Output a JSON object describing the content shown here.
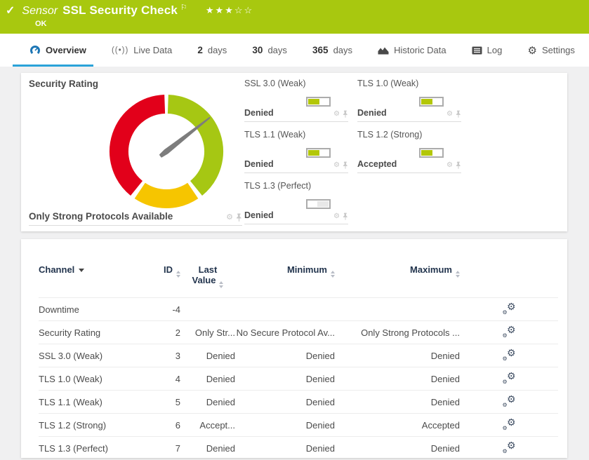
{
  "header": {
    "check": "✓",
    "kind": "Sensor",
    "title": "SSL Security Check",
    "flag": "⚐",
    "stars": "★★★☆☆",
    "status": "OK",
    "bg_color": "#a8c80f"
  },
  "tabs": {
    "overview": {
      "label": "Overview",
      "active": true
    },
    "live": {
      "label": "Live Data"
    },
    "d2": {
      "num": "2",
      "unit": "days"
    },
    "d30": {
      "num": "30",
      "unit": "days"
    },
    "d365": {
      "num": "365",
      "unit": "days"
    },
    "historic": {
      "label": "Historic Data"
    },
    "log": {
      "label": "Log"
    },
    "settings": {
      "label": "Settings"
    },
    "accent_underline_color": "#2aa2d8"
  },
  "gauge_panel": {
    "title": "Security Rating",
    "value": "Only Strong Protocols Available",
    "gauge": {
      "ring_outer": 81,
      "ring_inner": 54,
      "needle_deg": 52,
      "needle_color": "#7d7d7d",
      "segments": [
        {
          "name": "weak-red",
          "color": "#e2001a",
          "from": 219,
          "to": 358
        },
        {
          "name": "caution-yellow",
          "color": "#f6c500",
          "from": 146,
          "to": 214
        },
        {
          "name": "strong-green",
          "color": "#a6c713",
          "from": 2,
          "to": 141
        }
      ]
    }
  },
  "tiles": [
    {
      "title": "SSL 3.0 (Weak)",
      "value": "Denied",
      "bar": {
        "color": "#b3c708",
        "align": "left",
        "fill": 0.55
      }
    },
    {
      "title": "TLS 1.0 (Weak)",
      "value": "Denied",
      "bar": {
        "color": "#b3c708",
        "align": "left",
        "fill": 0.55
      }
    },
    {
      "title": "TLS 1.1 (Weak)",
      "value": "Denied",
      "bar": {
        "color": "#b3c708",
        "align": "left",
        "fill": 0.55
      }
    },
    {
      "title": "TLS 1.2 (Strong)",
      "value": "Accepted",
      "bar": {
        "color": "#b3c708",
        "align": "left",
        "fill": 0.55
      }
    },
    {
      "title": "TLS 1.3 (Perfect)",
      "value": "Denied",
      "bar": {
        "color": "#e8e8e8",
        "align": "right",
        "fill": 0.55
      }
    }
  ],
  "table": {
    "headers": {
      "channel": "Channel",
      "id": "ID",
      "last_line1": "Last",
      "last_line2": "Value",
      "minimum": "Minimum",
      "maximum": "Maximum"
    },
    "rows": [
      {
        "channel": "Downtime",
        "id": "-4",
        "last": "",
        "min": "",
        "max": ""
      },
      {
        "channel": "Security Rating",
        "id": "2",
        "last": "Only Str...",
        "min": "No Secure Protocol Av...",
        "max": "Only Strong Protocols ..."
      },
      {
        "channel": "SSL 3.0 (Weak)",
        "id": "3",
        "last": "Denied",
        "min": "Denied",
        "max": "Denied"
      },
      {
        "channel": "TLS 1.0 (Weak)",
        "id": "4",
        "last": "Denied",
        "min": "Denied",
        "max": "Denied"
      },
      {
        "channel": "TLS 1.1 (Weak)",
        "id": "5",
        "last": "Denied",
        "min": "Denied",
        "max": "Denied"
      },
      {
        "channel": "TLS 1.2 (Strong)",
        "id": "6",
        "last": "Accept...",
        "min": "Denied",
        "max": "Accepted"
      },
      {
        "channel": "TLS 1.3 (Perfect)",
        "id": "7",
        "last": "Denied",
        "min": "Denied",
        "max": "Denied"
      }
    ]
  }
}
